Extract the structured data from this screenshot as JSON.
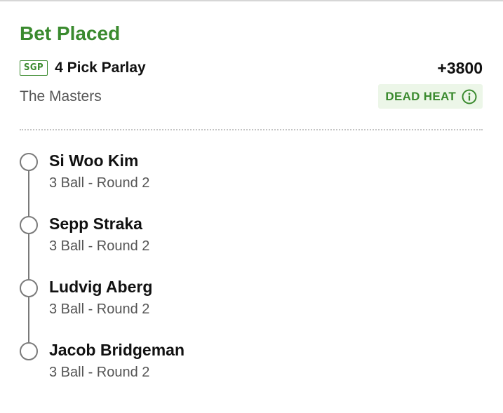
{
  "bet": {
    "status": "Bet Placed",
    "badge": "SGP",
    "type": "4 Pick Parlay",
    "odds": "+3800",
    "event": "The Masters",
    "dead_heat_label": "DEAD HEAT",
    "accent_color": "#3a8a2e"
  },
  "legs": [
    {
      "name": "Si Woo Kim",
      "market": "3 Ball - Round 2"
    },
    {
      "name": "Sepp Straka",
      "market": "3 Ball - Round 2"
    },
    {
      "name": "Ludvig Aberg",
      "market": "3 Ball - Round 2"
    },
    {
      "name": "Jacob Bridgeman",
      "market": "3 Ball - Round 2"
    }
  ],
  "icons": {
    "dead_heat_info": "info-circle-icon"
  }
}
